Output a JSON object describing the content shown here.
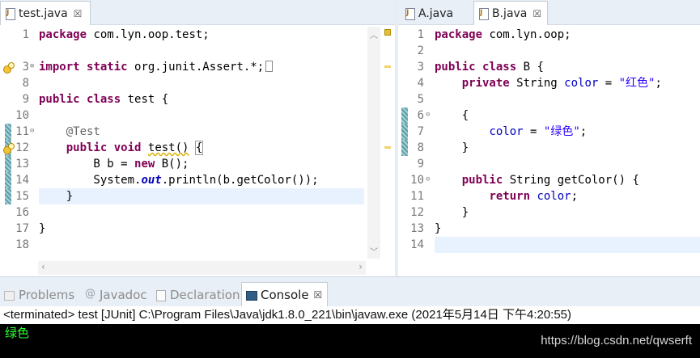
{
  "left_editor": {
    "tab": {
      "label": "test.java",
      "close": "☒"
    },
    "lines": [
      {
        "num": "1",
        "html_key": "l1",
        "text": "package com.lyn.oop.test;"
      },
      {
        "num": "3",
        "text": "import static org.junit.Assert.*;"
      },
      {
        "num": "8",
        "text": ""
      },
      {
        "num": "9",
        "text": "public class test {"
      },
      {
        "num": "10",
        "text": ""
      },
      {
        "num": "11",
        "text": "    @Test"
      },
      {
        "num": "12",
        "text": "    public void test() {"
      },
      {
        "num": "13",
        "text": "        B b = new B();"
      },
      {
        "num": "14",
        "text": "        System.out.println(b.getColor());"
      },
      {
        "num": "15",
        "text": "    }"
      },
      {
        "num": "16",
        "text": ""
      },
      {
        "num": "17",
        "text": "}"
      },
      {
        "num": "18",
        "text": ""
      }
    ]
  },
  "right_editor": {
    "tabs": [
      {
        "label": "A.java"
      },
      {
        "label": "B.java",
        "close": "☒"
      }
    ],
    "lines": [
      {
        "num": "1",
        "text": "package com.lyn.oop;"
      },
      {
        "num": "2",
        "text": ""
      },
      {
        "num": "3",
        "text": "public class B {"
      },
      {
        "num": "4",
        "text": "    private String color = \"红色\";"
      },
      {
        "num": "5",
        "text": ""
      },
      {
        "num": "6",
        "text": "    {"
      },
      {
        "num": "7",
        "text": "        color = \"绿色\";"
      },
      {
        "num": "8",
        "text": "    }"
      },
      {
        "num": "9",
        "text": ""
      },
      {
        "num": "10",
        "text": "    public String getColor() {"
      },
      {
        "num": "11",
        "text": "        return color;"
      },
      {
        "num": "12",
        "text": "    }"
      },
      {
        "num": "13",
        "text": "}"
      },
      {
        "num": "14",
        "text": ""
      }
    ]
  },
  "bottom_tabs": [
    {
      "label": "Problems",
      "icon": "problems-icon"
    },
    {
      "label": "Javadoc",
      "icon": "javadoc-icon"
    },
    {
      "label": "Declaration",
      "icon": "declaration-icon"
    },
    {
      "label": "Console",
      "icon": "console-icon",
      "close": "☒"
    }
  ],
  "console": {
    "status": "<terminated> test [JUnit] C:\\Program Files\\Java\\jdk1.8.0_221\\bin\\javaw.exe (2021年5月14日 下午4:20:55)",
    "output": "绿色",
    "watermark": "https://blog.csdn.net/qwserft"
  },
  "colors": {
    "keyword": "#7f0055",
    "string": "#2a00ff",
    "field": "#0000c0",
    "annotation": "#646464",
    "console_output": "#33ff33"
  }
}
